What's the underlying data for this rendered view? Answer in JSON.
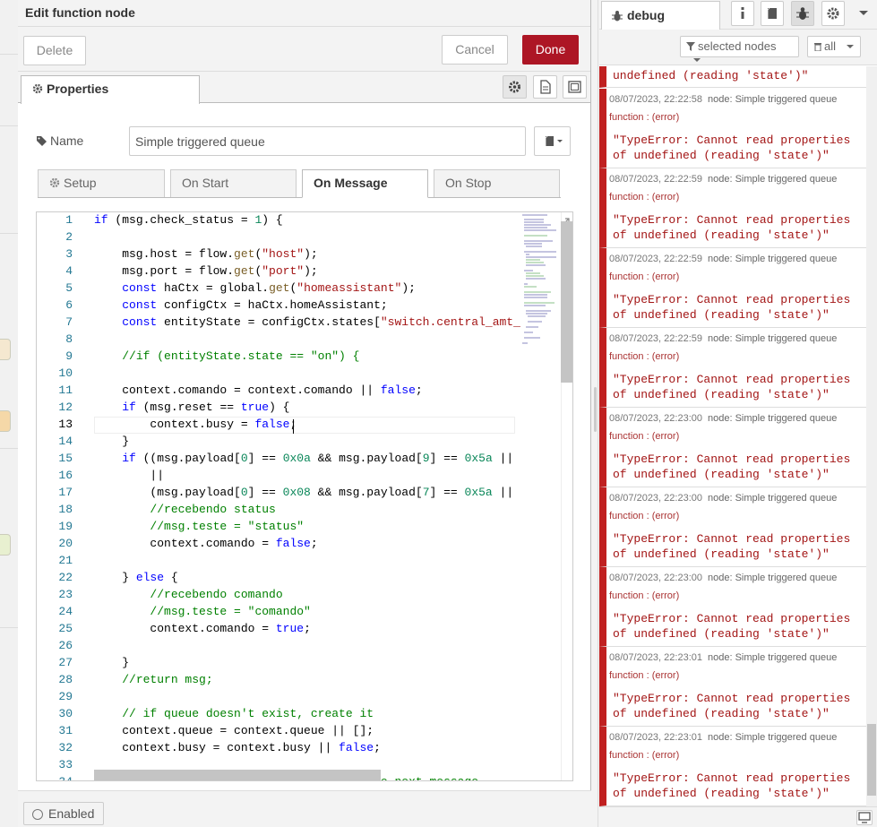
{
  "tray": {
    "title": "Edit function node",
    "delete_label": "Delete",
    "cancel_label": "Cancel",
    "done_label": "Done",
    "properties_tab": "Properties",
    "name_label": "Name",
    "name_value": "Simple triggered queue",
    "code_tabs": [
      "Setup",
      "On Start",
      "On Message",
      "On Stop"
    ],
    "active_code_tab": "On Message",
    "enabled_label": "Enabled"
  },
  "editor": {
    "line_numbers": [
      "1",
      "2",
      "3",
      "4",
      "5",
      "6",
      "7",
      "8",
      "9",
      "10",
      "11",
      "12",
      "13",
      "14",
      "15",
      "16",
      "17",
      "18",
      "19",
      "20",
      "21",
      "22",
      "23",
      "24",
      "25",
      "26",
      "27",
      "28",
      "29",
      "30",
      "31",
      "32",
      "33",
      "34"
    ],
    "current_line": 13
  },
  "sidebar": {
    "active_tab": "debug",
    "filter_label": "selected nodes",
    "clear_label": "all",
    "first_partial_body": "undefined (reading 'state')\"",
    "messages": [
      {
        "time": "08/07/2023, 22:22:58",
        "node": "node: Simple triggered queue",
        "source": "function : (error)",
        "body": "\"TypeError: Cannot read properties of undefined (reading 'state')\""
      },
      {
        "time": "08/07/2023, 22:22:59",
        "node": "node: Simple triggered queue",
        "source": "function : (error)",
        "body": "\"TypeError: Cannot read properties of undefined (reading 'state')\""
      },
      {
        "time": "08/07/2023, 22:22:59",
        "node": "node: Simple triggered queue",
        "source": "function : (error)",
        "body": "\"TypeError: Cannot read properties of undefined (reading 'state')\""
      },
      {
        "time": "08/07/2023, 22:22:59",
        "node": "node: Simple triggered queue",
        "source": "function : (error)",
        "body": "\"TypeError: Cannot read properties of undefined (reading 'state')\""
      },
      {
        "time": "08/07/2023, 22:23:00",
        "node": "node: Simple triggered queue",
        "source": "function : (error)",
        "body": "\"TypeError: Cannot read properties of undefined (reading 'state')\""
      },
      {
        "time": "08/07/2023, 22:23:00",
        "node": "node: Simple triggered queue",
        "source": "function : (error)",
        "body": "\"TypeError: Cannot read properties of undefined (reading 'state')\""
      },
      {
        "time": "08/07/2023, 22:23:00",
        "node": "node: Simple triggered queue",
        "source": "function : (error)",
        "body": "\"TypeError: Cannot read properties of undefined (reading 'state')\""
      },
      {
        "time": "08/07/2023, 22:23:01",
        "node": "node: Simple triggered queue",
        "source": "function : (error)",
        "body": "\"TypeError: Cannot read properties of undefined (reading 'state')\""
      },
      {
        "time": "08/07/2023, 22:23:01",
        "node": "node: Simple triggered queue",
        "source": "function : (error)",
        "body": "\"TypeError: Cannot read properties of undefined (reading 'state')\""
      }
    ]
  },
  "colors": {
    "done_button": "#ad1625",
    "error_bar": "#c02020",
    "keyword": "#0000ff",
    "string": "#a31515",
    "comment": "#008000",
    "number": "#098658",
    "line_number": "#237893"
  },
  "icons": [
    "gear-icon",
    "file-text-icon",
    "window-icon",
    "tag-icon",
    "book-icon",
    "bug-icon",
    "info-icon",
    "filter-icon",
    "trash-icon",
    "monitor-icon",
    "expand-icon"
  ]
}
